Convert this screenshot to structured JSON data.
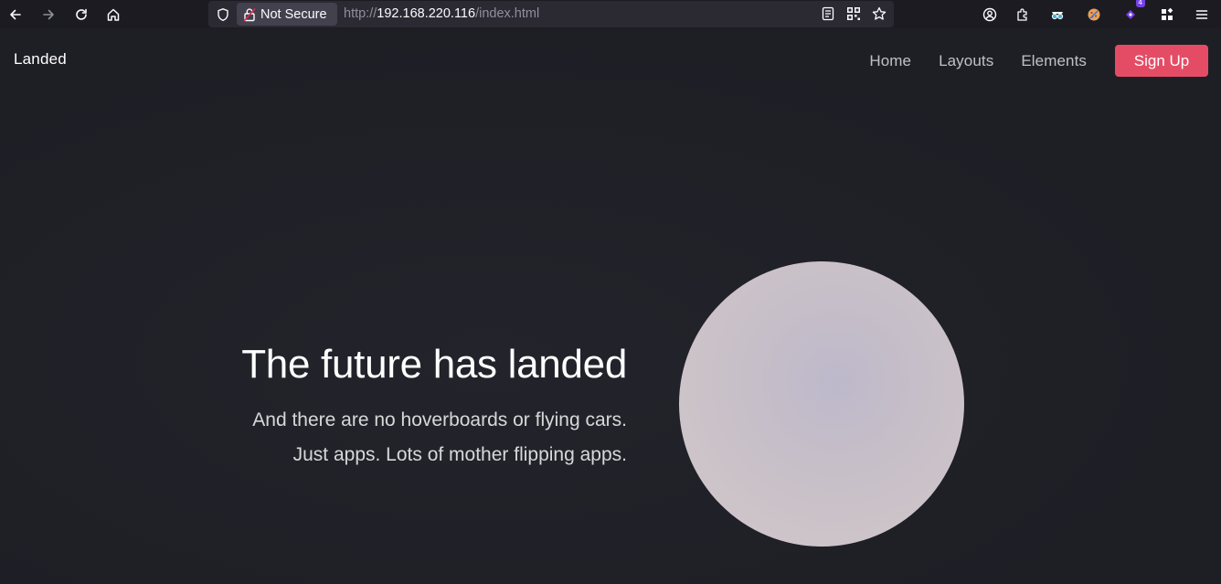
{
  "browser": {
    "not_secure_label": "Not Secure",
    "url_scheme": "http://",
    "url_host": "192.168.220.116",
    "url_path": "/index.html",
    "extension_badge": "4"
  },
  "site": {
    "brand": "Landed",
    "nav": {
      "home": "Home",
      "layouts": "Layouts",
      "elements": "Elements",
      "signup": "Sign Up"
    },
    "hero": {
      "title": "The future has landed",
      "subtitle_line1": "And there are no hoverboards or flying cars.",
      "subtitle_line2": "Just apps. Lots of mother flipping apps."
    }
  },
  "colors": {
    "accent": "#e44c65",
    "page_background": "#1f1f26",
    "toolbar_background": "#1c1b22"
  }
}
